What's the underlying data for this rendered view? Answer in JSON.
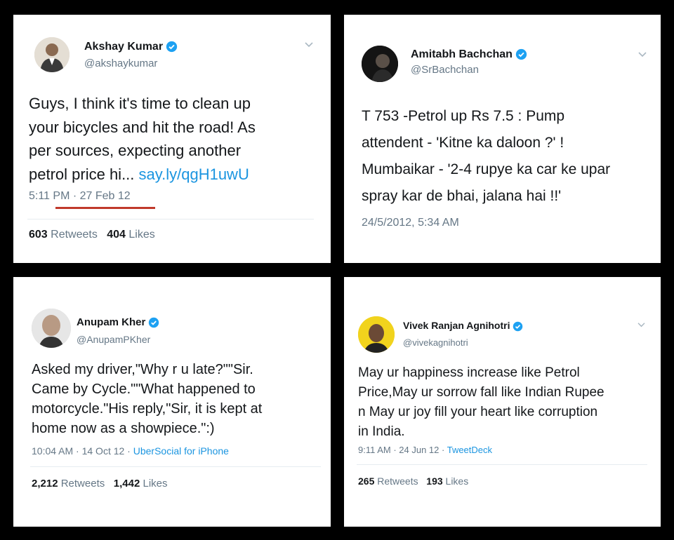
{
  "tweets": [
    {
      "name": "Akshay Kumar",
      "handle": "@akshaykumar",
      "text": "Guys, I think it's time to clean up\nyour bicycles  and hit the road! As\nper sources, expecting another\npetrol price hi... ",
      "link": "say.ly/qgH1uwU",
      "time": "5:11 PM · 27 Feb 12",
      "retweets": "603",
      "retweets_label": "Retweets",
      "likes": "404",
      "likes_label": "Likes"
    },
    {
      "name": "Amitabh Bachchan",
      "handle": "@SrBachchan",
      "text": "T 753 -Petrol up Rs 7.5 : Pump\nattendent - 'Kitne ka daloon ?' !\nMumbaikar - '2-4 rupye ka car ke upar\nspray kar de bhai, jalana  hai !!'",
      "time": "24/5/2012, 5:34 AM"
    },
    {
      "name": "Anupam Kher",
      "handle": "@AnupamPKher",
      "text": "Asked my driver,\"Why r u late?\"\"Sir.\nCame by Cycle.\"\"What happened to\nmotorcycle.\"His reply,\"Sir, it is kept at\nhome now as a showpiece.\":)",
      "time": "10:04 AM · 14 Oct 12 · ",
      "source": "UberSocial for iPhone",
      "retweets": "2,212",
      "retweets_label": "Retweets",
      "likes": "1,442",
      "likes_label": "Likes"
    },
    {
      "name": "Vivek Ranjan Agnihotri",
      "handle": "@vivekagnihotri",
      "text": "May ur happiness increase like Petrol\nPrice,May ur sorrow fall like Indian Rupee\nn May ur joy fill your heart like corruption\nin India.",
      "time": "9:11 AM · 24 Jun 12 · ",
      "source": "TweetDeck",
      "retweets": "265",
      "retweets_label": "Retweets",
      "likes": "193",
      "likes_label": "Likes"
    }
  ],
  "colors": {
    "verified": "#1da1f2",
    "link": "#1b95e0",
    "underline": "#c0392b"
  }
}
